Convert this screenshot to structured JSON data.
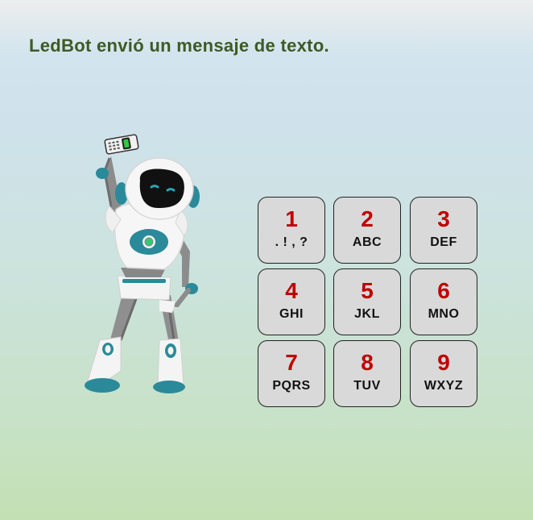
{
  "header": {
    "title": "LedBot envió un mensaje de texto."
  },
  "keypad": {
    "keys": [
      {
        "digit": "1",
        "letters": ". ! , ?"
      },
      {
        "digit": "2",
        "letters": "ABC"
      },
      {
        "digit": "3",
        "letters": "DEF"
      },
      {
        "digit": "4",
        "letters": "GHI"
      },
      {
        "digit": "5",
        "letters": "JKL"
      },
      {
        "digit": "6",
        "letters": "MNO"
      },
      {
        "digit": "7",
        "letters": "PQRS"
      },
      {
        "digit": "8",
        "letters": "TUV"
      },
      {
        "digit": "9",
        "letters": "WXYZ"
      }
    ]
  },
  "colors": {
    "title": "#3d5a24",
    "digit": "#c00000",
    "key_bg": "#d9d9d9",
    "robot_accent": "#2a8a9a"
  }
}
